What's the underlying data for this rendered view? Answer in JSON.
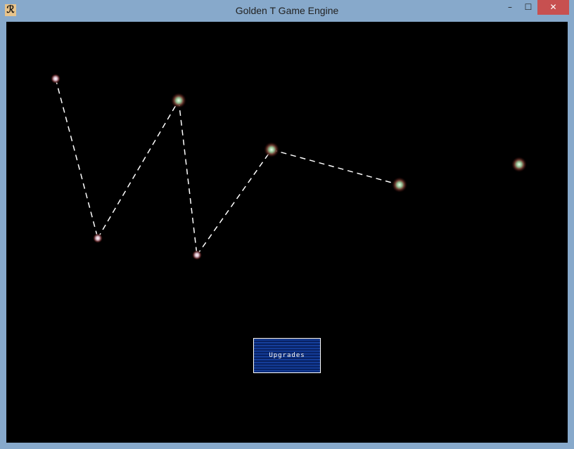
{
  "window": {
    "title": "Golden T Game Engine",
    "minimize": "–",
    "maximize": "☐",
    "close": "✕"
  },
  "game": {
    "upgrades_label": "Upgrades",
    "colors": {
      "background": "#000000",
      "path": "#ffffff",
      "button_bg": "#1c4cb4"
    }
  }
}
